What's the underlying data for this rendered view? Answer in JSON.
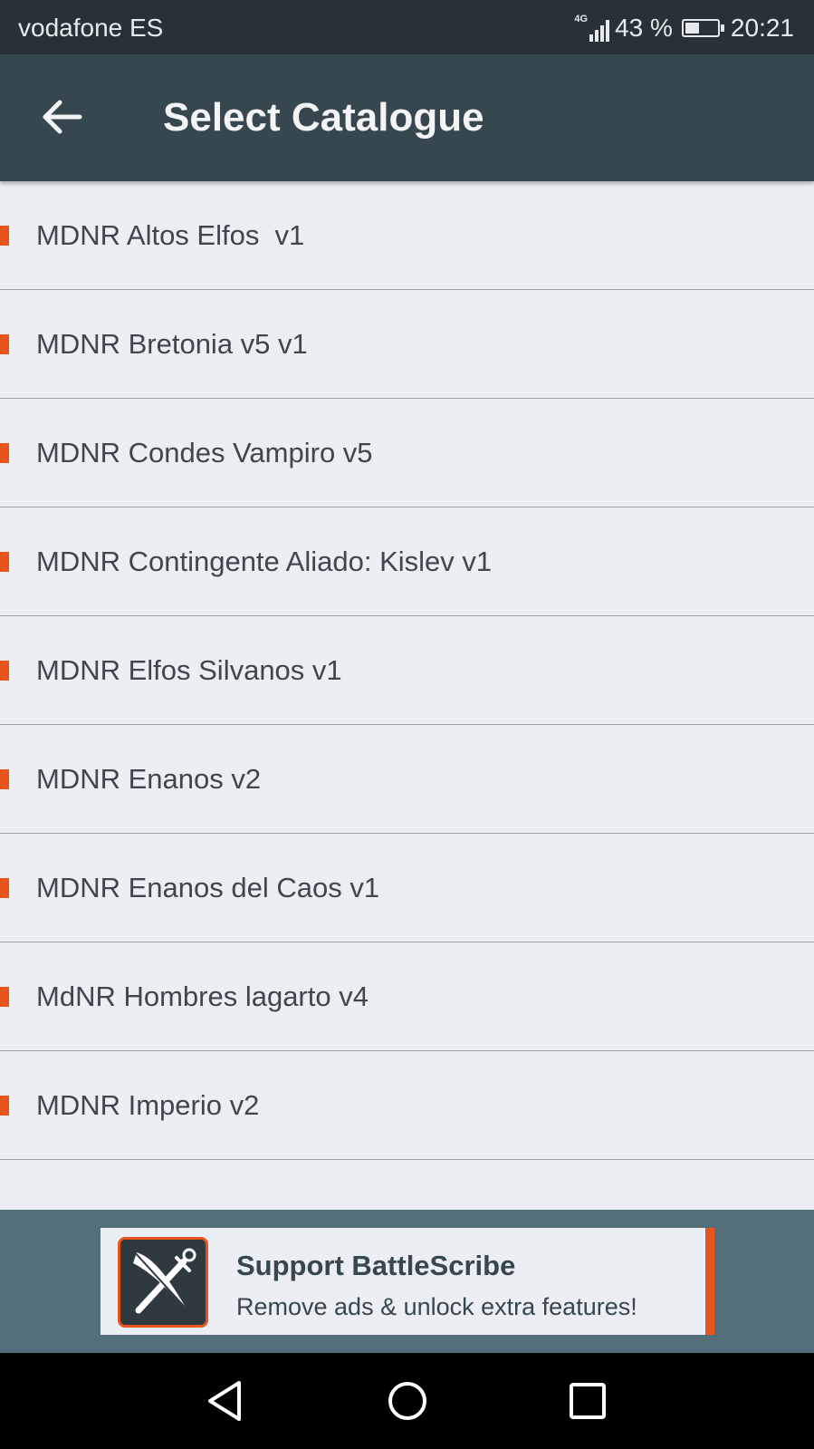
{
  "status_bar": {
    "carrier": "vodafone ES",
    "network_type": "4G",
    "battery_percent_text": "43 %",
    "battery_level": 0.43,
    "time": "20:21"
  },
  "app_bar": {
    "back_icon": "arrow-left-icon",
    "title": "Select Catalogue"
  },
  "catalogues": [
    "MDNR Altos Elfos  v1",
    "MDNR Bretonia v5 v1",
    "MDNR Condes Vampiro v5",
    "MDNR Contingente Aliado: Kislev v1",
    "MDNR Elfos Silvanos v1",
    "MDNR Enanos v2",
    "MDNR Enanos del Caos v1",
    "MdNR Hombres lagarto v4",
    "MDNR Imperio v2",
    ""
  ],
  "ad": {
    "logo_icon": "quill-and-sword-icon",
    "title": "Support BattleScribe",
    "subtitle": "Remove ads & unlock extra features!"
  },
  "nav_bar": {
    "back_icon": "triangle-back-icon",
    "home_icon": "circle-home-icon",
    "recents_icon": "square-recents-icon"
  },
  "colors": {
    "status_bar": "#263238",
    "app_bar": "#37474f",
    "list_background": "#ebeef2",
    "accent": "#e8541c",
    "ad_area": "#546e7a"
  }
}
